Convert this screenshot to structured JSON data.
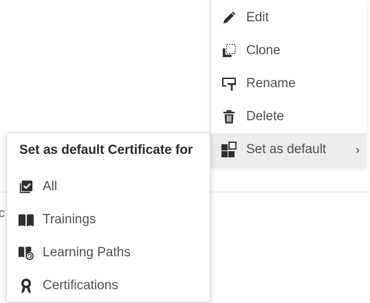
{
  "background": {
    "partial_text": "c"
  },
  "context_menu": {
    "items": [
      {
        "label": "Edit",
        "icon": "pencil-icon"
      },
      {
        "label": "Clone",
        "icon": "clone-icon"
      },
      {
        "label": "Rename",
        "icon": "rename-icon"
      },
      {
        "label": "Delete",
        "icon": "trash-icon"
      },
      {
        "label": "Set as default",
        "icon": "set-default-icon",
        "active": true,
        "has_submenu": true
      }
    ],
    "chevron": "›"
  },
  "submenu": {
    "title": "Set as default Certificate for",
    "items": [
      {
        "label": "All",
        "icon": "checkbox-icon"
      },
      {
        "label": "Trainings",
        "icon": "book-icon"
      },
      {
        "label": "Learning Paths",
        "icon": "learning-path-icon"
      },
      {
        "label": "Certifications",
        "icon": "award-icon"
      }
    ]
  },
  "colors": {
    "text": "#4f4f4f",
    "title": "#2b2b2b",
    "icon": "#2f2f2f",
    "active_bg": "#ececec"
  }
}
